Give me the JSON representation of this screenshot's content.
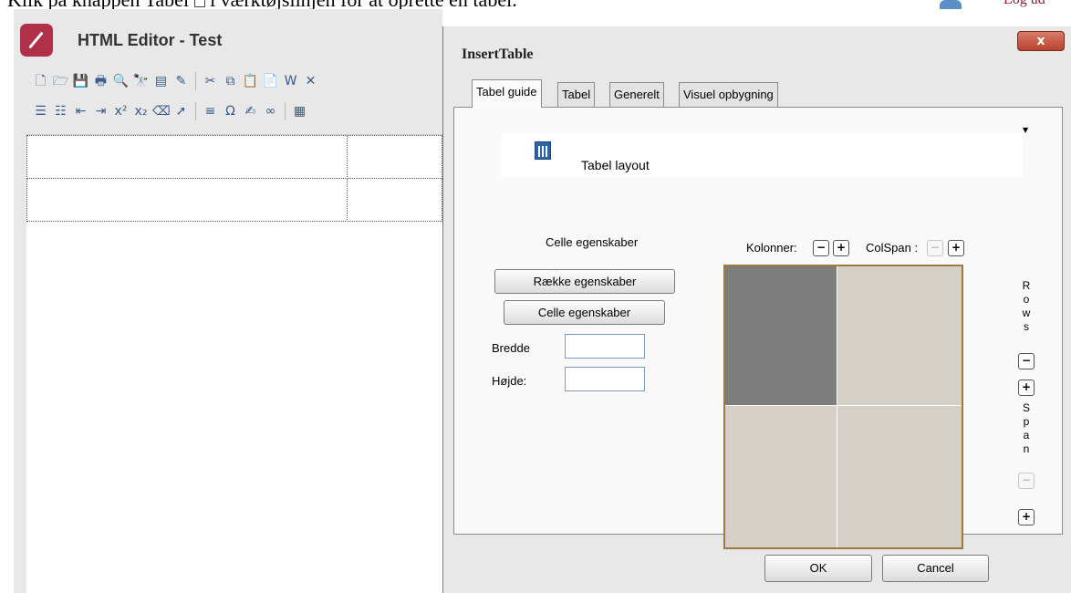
{
  "header": {
    "instruction_text": "Klik på knappen Tabel",
    "instruction_text_after": "i værktøjslinjen for at oprette en tabel.",
    "logout_label": "Log ud"
  },
  "editor": {
    "title": "HTML Editor - Test",
    "toolbar_row1": [
      {
        "icon": "new-document-icon",
        "glyph": "🗋"
      },
      {
        "icon": "open-folder-icon",
        "glyph": "🗁"
      },
      {
        "icon": "save-icon",
        "glyph": "💾"
      },
      {
        "icon": "print-icon",
        "glyph": "🖶"
      },
      {
        "icon": "print-preview-icon",
        "glyph": "🔍"
      },
      {
        "icon": "find-icon",
        "glyph": "🔭"
      },
      {
        "icon": "template-icon",
        "glyph": "▤"
      },
      {
        "icon": "clean-format-icon",
        "glyph": "✎"
      },
      {
        "icon": "cut-icon",
        "glyph": "✂"
      },
      {
        "icon": "copy-icon",
        "glyph": "⧉"
      },
      {
        "icon": "paste-icon",
        "glyph": "📋"
      },
      {
        "icon": "paste-text-icon",
        "glyph": "📄"
      },
      {
        "icon": "paste-word-icon",
        "glyph": "W"
      },
      {
        "icon": "delete-icon",
        "glyph": "✕"
      }
    ],
    "toolbar_row2": [
      {
        "icon": "ordered-list-icon",
        "glyph": "☰"
      },
      {
        "icon": "unordered-list-icon",
        "glyph": "☷"
      },
      {
        "icon": "outdent-icon",
        "glyph": "⇤"
      },
      {
        "icon": "indent-icon",
        "glyph": "⇥"
      },
      {
        "icon": "superscript-icon",
        "glyph": "x²"
      },
      {
        "icon": "subscript-icon",
        "glyph": "x₂"
      },
      {
        "icon": "eraser-icon",
        "glyph": "⌫"
      },
      {
        "icon": "select-pointer-icon",
        "glyph": "➚"
      },
      {
        "icon": "horizontal-rule-icon",
        "glyph": "≡"
      },
      {
        "icon": "special-character-icon",
        "glyph": "Ω"
      },
      {
        "icon": "spellcheck-icon",
        "glyph": "✍"
      },
      {
        "icon": "link-icon",
        "glyph": "∞"
      },
      {
        "icon": "insert-table-icon",
        "glyph": "▦"
      }
    ]
  },
  "dialog": {
    "title": "InsertTable",
    "close_label": "x",
    "tabs": [
      {
        "label": "Tabel guide"
      },
      {
        "label": "Tabel"
      },
      {
        "label": "Generelt"
      },
      {
        "label": "Visuel opbygning"
      }
    ],
    "layout_selector_label": "Tabel layout",
    "cell_props_title": "Celle egenskaber",
    "row_props_button": "Række egenskaber",
    "cell_props_button": "Celle egenskaber",
    "width_label": "Bredde",
    "width_value": "",
    "height_label": "Højde:",
    "height_value": "",
    "columns_label": "Kolonner:",
    "colspan_label": "ColSpan :",
    "minus": "−",
    "plus": "+",
    "rows_letters": [
      "R",
      "o",
      "w",
      "s"
    ],
    "span_letters": [
      "S",
      "p",
      "a",
      "n"
    ],
    "ok_label": "OK",
    "cancel_label": "Cancel",
    "selected_cell_color": "#7d7d7d",
    "table_bg_color": "#d4d0c8",
    "table_border_color": "#a07a3a"
  }
}
